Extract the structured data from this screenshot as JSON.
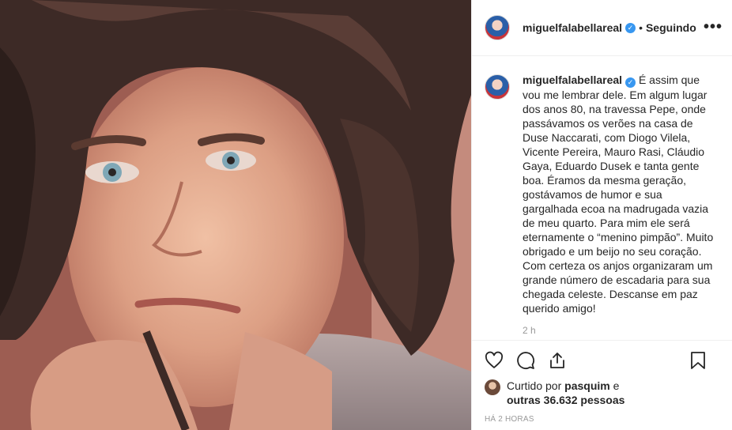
{
  "post": {
    "photo_alt": "Foto de homem de cabelos castanhos e olhos claros"
  },
  "header": {
    "username": "miguelfalabellareal",
    "verified_mark": "✓",
    "separator": "•",
    "follow_label": "Seguindo",
    "more_label": "•••"
  },
  "caption": {
    "username": "miguelfalabellareal",
    "verified_mark": "✓",
    "text": "É assim que vou me lembrar dele. Em algum lugar dos anos 80, na travessa Pepe, onde passávamos os verões na casa de Duse Naccarati, com Diogo Vilela, Vicente Pereira, Mauro Rasi, Cláudio Gaya, Eduardo Dusek e tanta gente boa. Éramos da mesma geração, gostávamos de humor e sua gargalhada ecoa na madrugada vazia de meu quarto. Para mim ele será eternamente o “menino pimpão”. Muito obrigado e um beijo no seu coração. Com certeza os anjos organizaram um grande número de escadaria para sua chegada celeste. Descanse em paz querido amigo!",
    "time_ago": "2 h"
  },
  "actions": {
    "icons": [
      "heart-icon",
      "comment-icon",
      "share-icon",
      "bookmark-icon"
    ]
  },
  "likes": {
    "prefix": "Curtido por ",
    "user": "pasquim",
    "conj": " e",
    "others": "outras 36.632 pessoas"
  },
  "date_label": "HÁ 2 HORAS",
  "colors": {
    "verified": "#3897f0",
    "text": "#262626",
    "muted": "#999999",
    "border": "#efefef"
  }
}
